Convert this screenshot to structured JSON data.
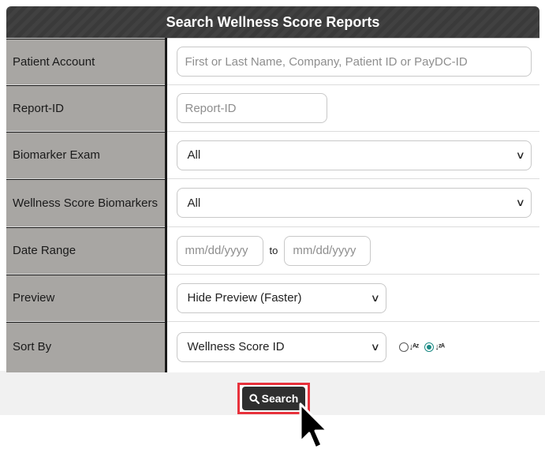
{
  "form": {
    "title": "Search Wellness Score Reports",
    "patient_account": {
      "label": "Patient Account",
      "placeholder": "First or Last Name, Company, Patient ID or PayDC-ID"
    },
    "report_id": {
      "label": "Report-ID",
      "placeholder": "Report-ID"
    },
    "biomarker_exam": {
      "label": "Biomarker Exam",
      "value": "All"
    },
    "wellness_biomarkers": {
      "label": "Wellness Score Biomarkers",
      "value": "All"
    },
    "date_range": {
      "label": "Date Range",
      "from_placeholder": "mm/dd/yyyy",
      "to_label": "to",
      "to_placeholder": "mm/dd/yyyy"
    },
    "preview": {
      "label": "Preview",
      "value": "Hide Preview (Faster)"
    },
    "sort_by": {
      "label": "Sort By",
      "value": "Wellness Score ID",
      "ascending_selected": false,
      "descending_selected": true
    },
    "search_button": "Search"
  },
  "colors": {
    "header_bg": "#3a3a3a",
    "label_bg": "#a8a6a3",
    "highlight": "#e8323c",
    "radio_accent": "#1b8a84"
  },
  "icons": {
    "search": "magnifier-icon",
    "sort_asc": "sort-a-z-icon",
    "sort_desc": "sort-z-a-icon",
    "cursor": "mouse-pointer-icon",
    "dropdown": "chevron-down-icon"
  }
}
